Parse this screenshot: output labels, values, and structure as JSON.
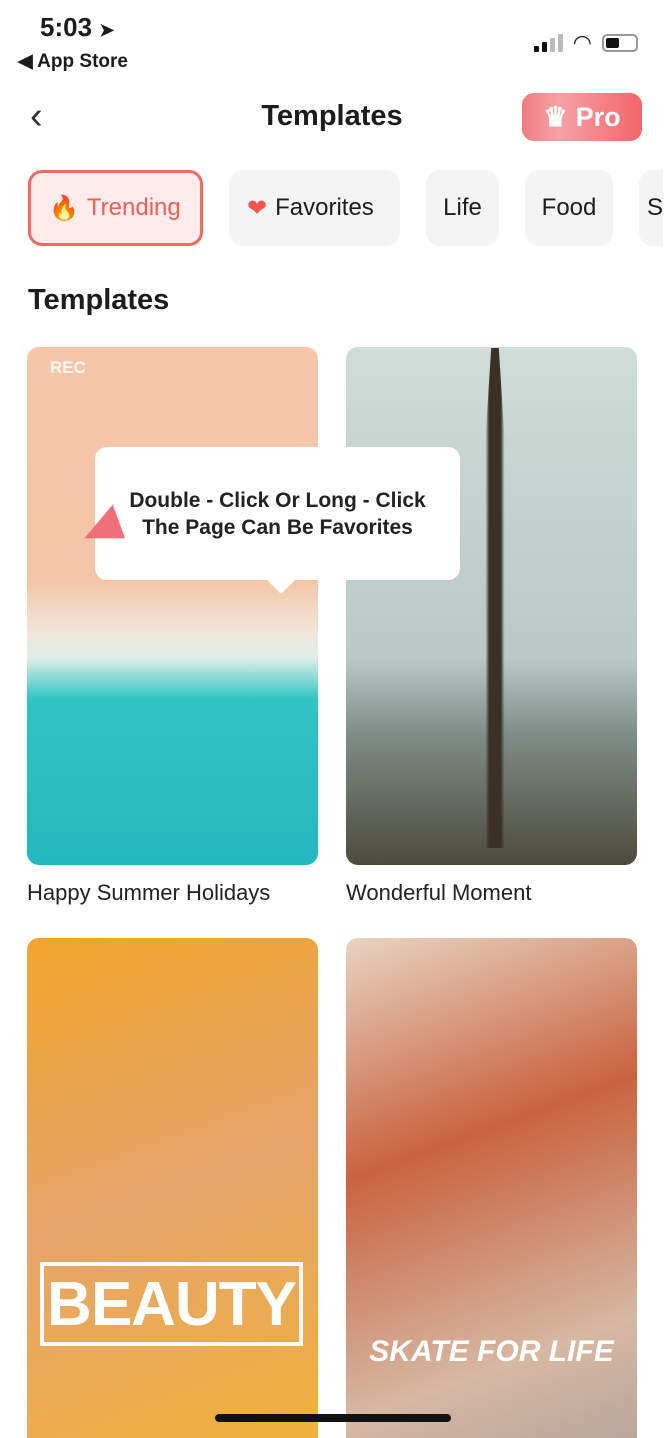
{
  "status": {
    "time": "5:03",
    "back_app": "◀ App Store"
  },
  "nav": {
    "title": "Templates",
    "pro_label": "Pro"
  },
  "categories": [
    {
      "label": "Trending",
      "icon": "flame-icon",
      "active": true
    },
    {
      "label": "Favorites",
      "icon": "heart-icon"
    },
    {
      "label": "Life"
    },
    {
      "label": "Food"
    },
    {
      "label": "S"
    }
  ],
  "section_title": "Templates",
  "templates": [
    {
      "title": "Happy Summer Holidays",
      "overlay": "REC"
    },
    {
      "title": "Wonderful Moment"
    },
    {
      "title": "",
      "overlay": "BEAUTY"
    },
    {
      "title": "",
      "overlay": "SKATE FOR LIFE"
    }
  ],
  "tooltip": {
    "line1": "Double - Click Or Long - Click",
    "line2": "The Page Can Be Favorites"
  },
  "colors": {
    "accent": "#ef6c62",
    "pro": "#f2656a"
  }
}
